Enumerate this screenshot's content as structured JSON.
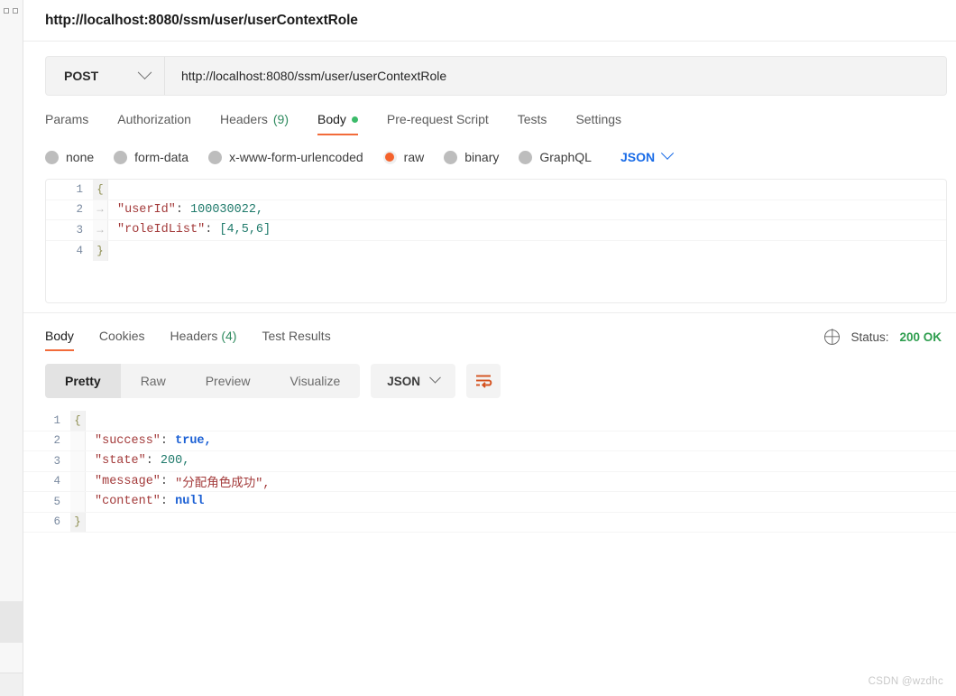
{
  "window": {
    "title": "http://localhost:8080/ssm/user/userContextRole",
    "watermark": "CSDN @wzdhc"
  },
  "request": {
    "method": "POST",
    "url": "http://localhost:8080/ssm/user/userContextRole",
    "tabs": [
      {
        "label": "Params",
        "active": false
      },
      {
        "label": "Authorization",
        "active": false
      },
      {
        "label": "Headers",
        "count": "(9)",
        "active": false
      },
      {
        "label": "Body",
        "active": true,
        "dot": true
      },
      {
        "label": "Pre-request Script",
        "active": false
      },
      {
        "label": "Tests",
        "active": false
      },
      {
        "label": "Settings",
        "active": false
      }
    ],
    "body_types": [
      {
        "label": "none",
        "selected": false
      },
      {
        "label": "form-data",
        "selected": false
      },
      {
        "label": "x-www-form-urlencoded",
        "selected": false
      },
      {
        "label": "raw",
        "selected": true
      },
      {
        "label": "binary",
        "selected": false
      },
      {
        "label": "GraphQL",
        "selected": false
      }
    ],
    "format": "JSON",
    "body_lines": [
      {
        "n": "1",
        "fold": "{",
        "key": "",
        "value": ""
      },
      {
        "n": "2",
        "fold": "→",
        "key": "\"userId\"",
        "value": "100030022,"
      },
      {
        "n": "3",
        "fold": "→",
        "key": "\"roleIdList\"",
        "value": "[4,5,6]"
      },
      {
        "n": "4",
        "fold": "}",
        "key": "",
        "value": ""
      }
    ]
  },
  "response": {
    "tabs": [
      {
        "label": "Body",
        "active": true
      },
      {
        "label": "Cookies",
        "active": false
      },
      {
        "label": "Headers",
        "count": "(4)",
        "active": false
      },
      {
        "label": "Test Results",
        "active": false
      }
    ],
    "status_label": "Status:",
    "status_code": "200 OK",
    "views": [
      {
        "label": "Pretty",
        "active": true
      },
      {
        "label": "Raw",
        "active": false
      },
      {
        "label": "Preview",
        "active": false
      },
      {
        "label": "Visualize",
        "active": false
      }
    ],
    "format": "JSON",
    "body_lines": [
      {
        "n": "1",
        "fold": "{",
        "key": "",
        "value": ""
      },
      {
        "n": "2",
        "fold": "",
        "key": "\"success\"",
        "value": "true,",
        "vtype": "bool"
      },
      {
        "n": "3",
        "fold": "",
        "key": "\"state\"",
        "value": "200,",
        "vtype": "num"
      },
      {
        "n": "4",
        "fold": "",
        "key": "\"message\"",
        "value": "\"分配角色成功\",",
        "vtype": "str"
      },
      {
        "n": "5",
        "fold": "",
        "key": "\"content\"",
        "value": "null",
        "vtype": "bool"
      },
      {
        "n": "6",
        "fold": "}",
        "key": "",
        "value": ""
      }
    ]
  },
  "colors": {
    "accent": "#f26b3a",
    "success": "#2f9e4f",
    "link": "#1a6ce7"
  }
}
